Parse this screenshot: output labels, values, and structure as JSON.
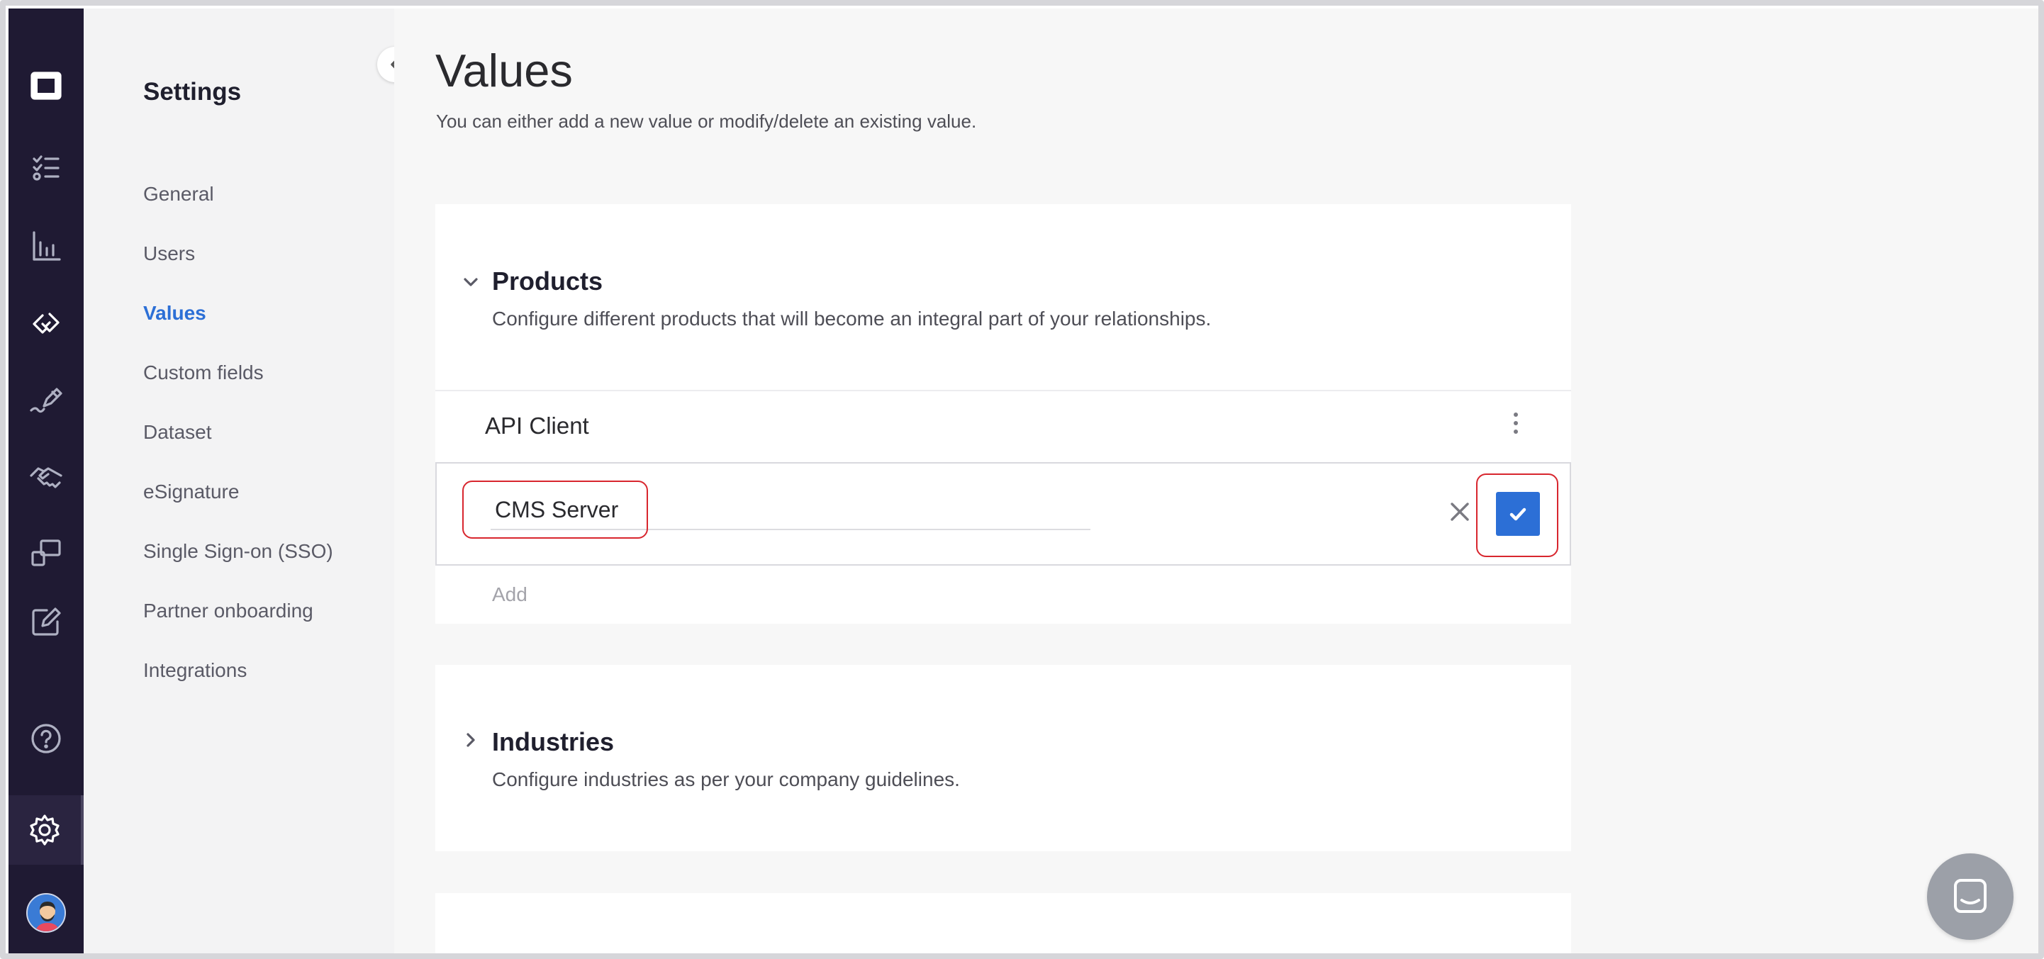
{
  "rail": {
    "items": [
      {
        "icon": "app-logo-icon"
      },
      {
        "icon": "checklist-icon"
      },
      {
        "icon": "bar-chart-icon"
      },
      {
        "icon": "link-icon",
        "active": true
      },
      {
        "icon": "pen-sign-icon"
      },
      {
        "icon": "handshake-icon"
      },
      {
        "icon": "screens-icon"
      },
      {
        "icon": "edit-icon"
      },
      {
        "icon": "help-icon"
      },
      {
        "icon": "gear-icon",
        "active": true
      }
    ],
    "avatar_icon": "user-avatar"
  },
  "sidebar": {
    "title": "Settings",
    "items": [
      {
        "label": "General"
      },
      {
        "label": "Users"
      },
      {
        "label": "Values",
        "active": true
      },
      {
        "label": "Custom fields"
      },
      {
        "label": "Dataset"
      },
      {
        "label": "eSignature"
      },
      {
        "label": "Single Sign-on (SSO)"
      },
      {
        "label": "Partner onboarding"
      },
      {
        "label": "Integrations"
      }
    ]
  },
  "main": {
    "title": "Values",
    "subtitle": "You can either add a new value or modify/delete an existing value.",
    "products": {
      "title": "Products",
      "description": "Configure different products that will become an integral part of your relationships.",
      "expanded": true,
      "items": [
        {
          "label": "API Client"
        }
      ],
      "edit_value": "CMS Server",
      "add_label": "Add"
    },
    "industries": {
      "title": "Industries",
      "description": "Configure industries as per your company guidelines.",
      "expanded": false
    }
  },
  "colors": {
    "rail_bg": "#1f1a33",
    "accent": "#2c6fd6",
    "highlight": "#d8262e"
  }
}
